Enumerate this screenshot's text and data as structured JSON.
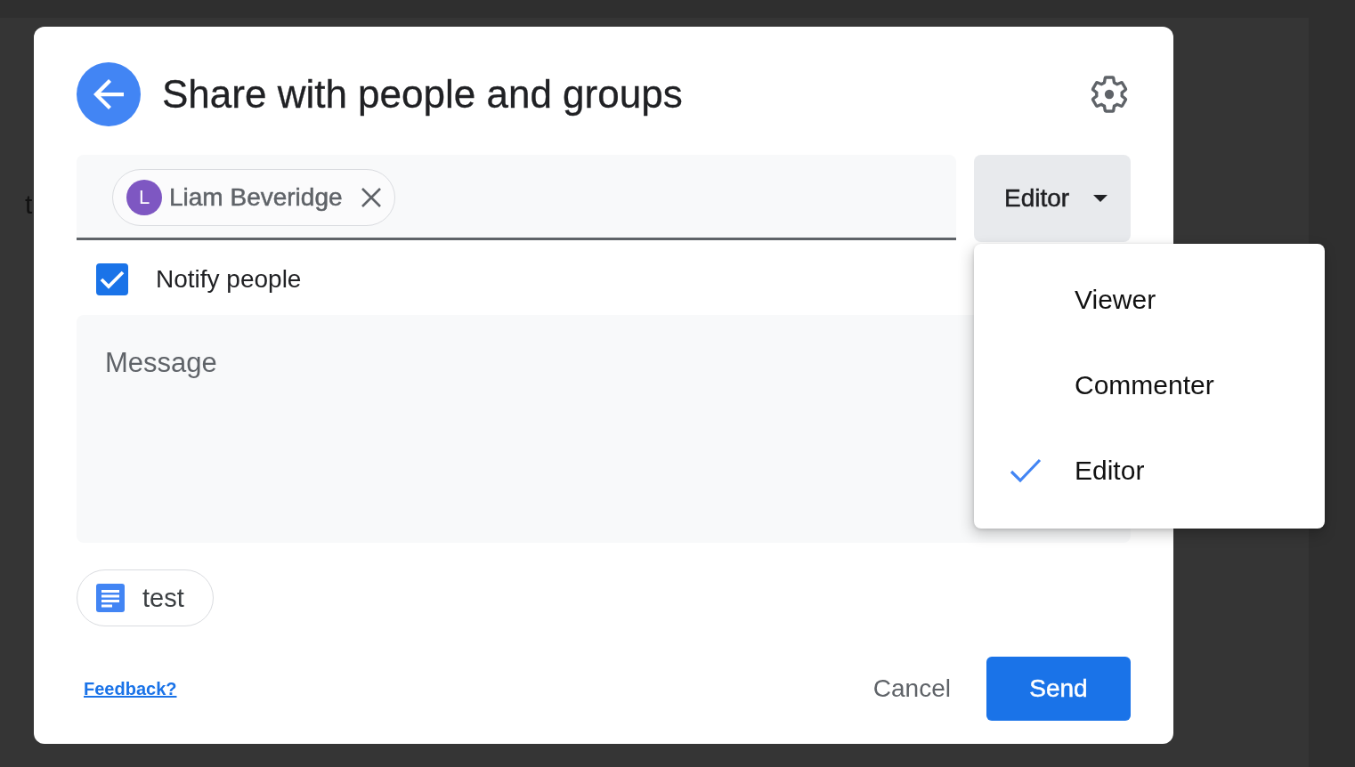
{
  "background": {
    "text_fragment": "t"
  },
  "dialog": {
    "title": "Share with people and groups"
  },
  "recipients": [
    {
      "initial": "L",
      "name": "Liam Beveridge",
      "color": "#7e57c2"
    }
  ],
  "role_dropdown": {
    "value": "Editor",
    "expanded": true
  },
  "notify": {
    "label": "Notify people",
    "checked": true
  },
  "message": {
    "placeholder": "Message"
  },
  "role_menu": {
    "items": [
      {
        "label": "Viewer",
        "selected": false
      },
      {
        "label": "Commenter",
        "selected": false
      },
      {
        "label": "Editor",
        "selected": true
      }
    ]
  },
  "attachment": {
    "name": "test"
  },
  "footer": {
    "feedback_link": "Feedback?",
    "cancel": "Cancel",
    "send": "Send"
  }
}
